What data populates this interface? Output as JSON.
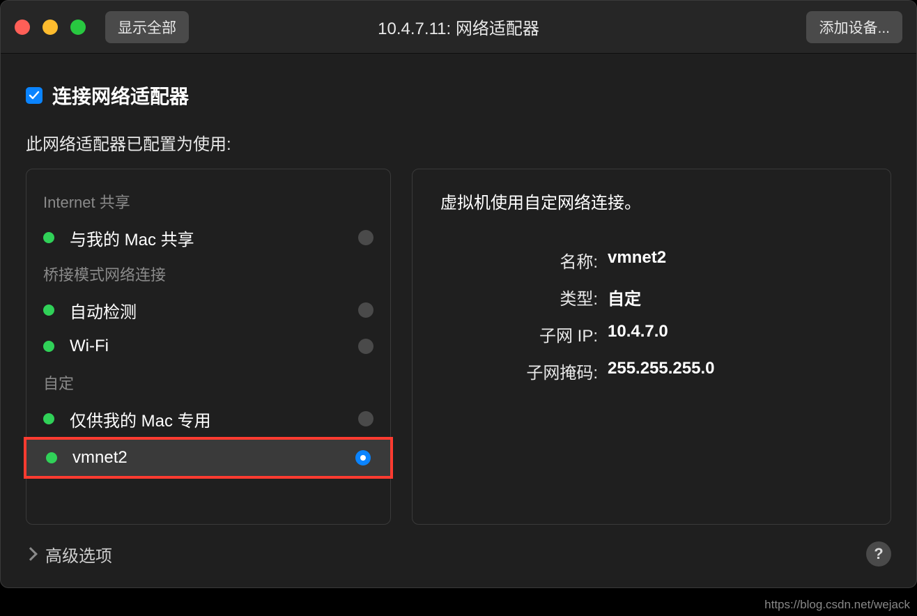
{
  "titlebar": {
    "show_all": "显示全部",
    "title": "10.4.7.11: 网络适配器",
    "add_device": "添加设备..."
  },
  "connect": {
    "label": "连接网络适配器",
    "checked": true
  },
  "subtitle": "此网络适配器已配置为使用:",
  "groups": {
    "internet_share": "Internet 共享",
    "bridged": "桥接模式网络连接",
    "custom": "自定"
  },
  "items": {
    "share_mac": "与我的 Mac 共享",
    "auto_detect": "自动检测",
    "wifi": "Wi-Fi",
    "mac_only": "仅供我的 Mac 专用",
    "vmnet2": "vmnet2"
  },
  "right": {
    "desc": "虚拟机使用自定网络连接。",
    "name_key": "名称:",
    "name_val": "vmnet2",
    "type_key": "类型:",
    "type_val": "自定",
    "subnet_ip_key": "子网 IP:",
    "subnet_ip_val": "10.4.7.0",
    "subnet_mask_key": "子网掩码:",
    "subnet_mask_val": "255.255.255.0"
  },
  "advanced": "高级选项",
  "watermark": "https://blog.csdn.net/wejack"
}
